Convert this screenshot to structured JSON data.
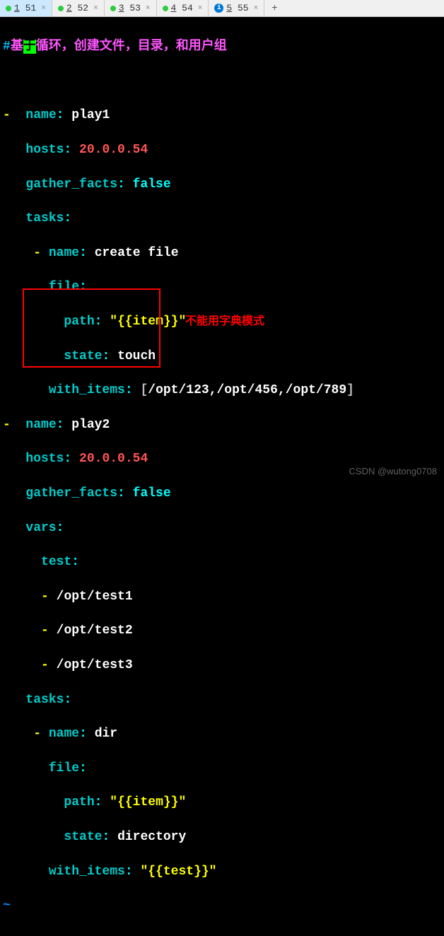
{
  "tabs": [
    {
      "num": "1",
      "label": "51",
      "status": "green",
      "active": true
    },
    {
      "num": "2",
      "label": "52",
      "status": "green",
      "active": false
    },
    {
      "num": "3",
      "label": "53",
      "status": "green",
      "active": false
    },
    {
      "num": "4",
      "label": "54",
      "status": "green",
      "active": false
    },
    {
      "num": "5",
      "label": "55",
      "status": "info",
      "active": false
    }
  ],
  "plus": "+",
  "comment": {
    "hash": "#",
    "pre": "基",
    "cursor": "于",
    "rest": "循环，创建文件，目录，和用户组"
  },
  "code": {
    "name_key": "name",
    "hosts_key": "hosts",
    "gather_key": "gather_facts",
    "tasks_key": "tasks",
    "file_key": "file",
    "path_key": "path",
    "state_key": "state",
    "with_key": "with_items",
    "vars_key": "vars",
    "test_key": "test",
    "play1": "play1",
    "play2": "play2",
    "host_ip": "20.0.0.54",
    "false_val": "false",
    "create_file": "create file",
    "item_tpl": "\"{{item}}\"",
    "touch": "touch",
    "dir": "dir",
    "directory": "directory",
    "test_tpl": "\"{{test}}\"",
    "lbracket": "[",
    "rbracket": "]",
    "list_items": "/opt/123,/opt/456,/opt/789",
    "test1": "/opt/test1",
    "test2": "/opt/test2",
    "test3": "/opt/test3",
    "dash": "-",
    "tilde": "~"
  },
  "annotation": "不能用字典模式",
  "watermark": "CSDN @wutong0708"
}
